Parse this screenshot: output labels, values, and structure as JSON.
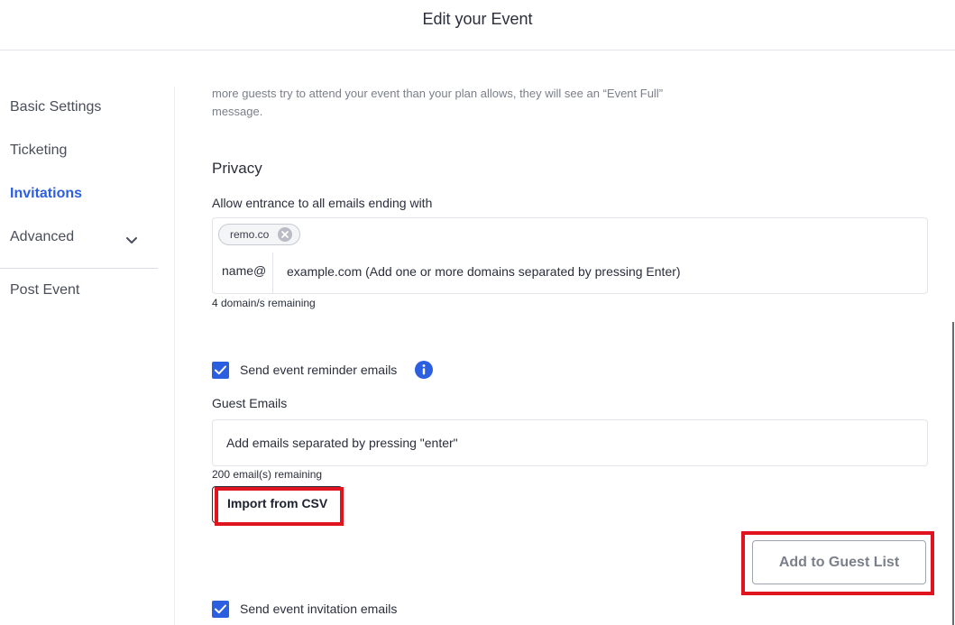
{
  "header": {
    "title": "Edit your Event"
  },
  "sidebar": {
    "items": [
      {
        "label": "Basic Settings"
      },
      {
        "label": "Ticketing"
      },
      {
        "label": "Invitations"
      },
      {
        "label": "Advanced"
      },
      {
        "label": "Post Event"
      }
    ],
    "active": "Invitations"
  },
  "main": {
    "intro_text_line1": "more guests try to attend your event than your plan allows, they will see an “Event Full”",
    "intro_text_line2": "message.",
    "privacy": {
      "title": "Privacy",
      "domain_label": "Allow entrance to all emails ending with",
      "chips": [
        "remo.co"
      ],
      "prefix": "name@",
      "domain_placeholder": "example.com (Add one or more domains separated by pressing Enter)",
      "remaining": "4 domain/s remaining"
    },
    "reminder": {
      "label": "Send event reminder emails",
      "checked": true
    },
    "guests": {
      "label": "Guest Emails",
      "placeholder": "Add emails separated by pressing \"enter\"",
      "remaining": "200 email(s) remaining",
      "import_label": "Import from CSV",
      "add_label": "Add to Guest List"
    },
    "invitation": {
      "label": "Send event invitation emails",
      "checked": true
    }
  },
  "colors": {
    "accent": "#2c5fe0",
    "highlight": "#e0141e",
    "text": "#2a2e3b",
    "muted": "#7b7f8a"
  },
  "icons": {
    "chevron": "chevron-down-icon",
    "chip_close": "close-circle-icon",
    "info": "info-icon",
    "check": "checkmark-icon"
  }
}
